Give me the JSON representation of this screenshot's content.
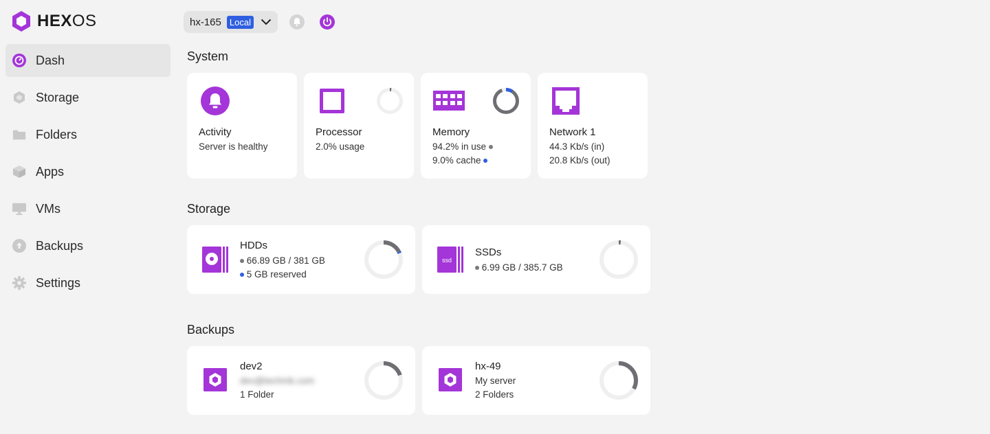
{
  "brand": {
    "hex": "HEX",
    "os": "OS"
  },
  "sidebar": {
    "items": [
      {
        "label": "Dash"
      },
      {
        "label": "Storage"
      },
      {
        "label": "Folders"
      },
      {
        "label": "Apps"
      },
      {
        "label": "VMs"
      },
      {
        "label": "Backups"
      },
      {
        "label": "Settings"
      }
    ]
  },
  "server": {
    "name": "hx-165",
    "badge": "Local"
  },
  "sections": {
    "system": "System",
    "storage": "Storage",
    "backups": "Backups"
  },
  "system_cards": {
    "activity": {
      "title": "Activity",
      "status": "Server is healthy"
    },
    "processor": {
      "title": "Processor",
      "usage": "2.0% usage",
      "usage_fraction": 0.02
    },
    "memory": {
      "title": "Memory",
      "in_use": "94.2% in use",
      "cache": "9.0% cache",
      "in_use_fraction": 0.942,
      "cache_fraction": 0.09
    },
    "network": {
      "title": "Network 1",
      "in": "44.3 Kb/s (in)",
      "out": "20.8 Kb/s (out)"
    }
  },
  "storage_cards": {
    "hdds": {
      "title": "HDDs",
      "used": "66.89 GB / 381 GB",
      "reserved": "5 GB reserved",
      "used_fraction": 0.176,
      "reserved_fraction": 0.013
    },
    "ssds": {
      "title": "SSDs",
      "used": "6.99 GB / 385.7 GB",
      "used_fraction": 0.018,
      "icon_text": "ssd"
    }
  },
  "backup_cards": {
    "dev2": {
      "title": "dev2",
      "subtitle": "dev@techmk.com",
      "folders": "1 Folder",
      "fraction": 0.2
    },
    "hx49": {
      "title": "hx-49",
      "subtitle": "My server",
      "folders": "2 Folders",
      "fraction": 0.33
    }
  },
  "colors": {
    "accent": "#a435d8",
    "blue": "#2f5fe0",
    "ring_gray": "#6e6e73",
    "ring_track": "#efefef"
  }
}
